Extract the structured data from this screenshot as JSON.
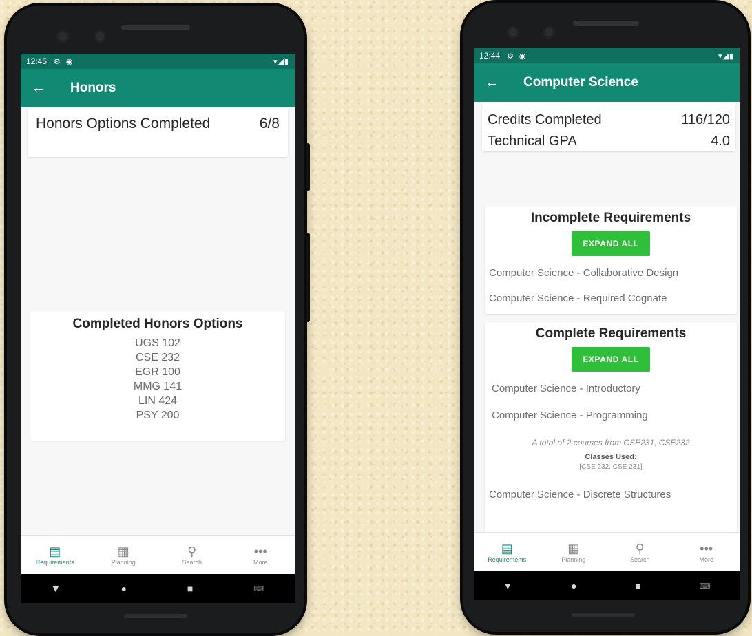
{
  "left": {
    "status": {
      "time": "12:45",
      "icons_left": [
        "⚙",
        "◉"
      ],
      "icons_right": "▾◢▮"
    },
    "appbar": {
      "title": "Honors"
    },
    "summary": {
      "label": "Honors Options Completed",
      "value": "6/8"
    },
    "completed": {
      "title": "Completed Honors Options",
      "items": [
        "UGS 102",
        "CSE 232",
        "EGR 100",
        "MMG 141",
        "LIN 424",
        "PSY 200"
      ]
    },
    "nav": [
      {
        "label": "Requirements",
        "icon": "requirements-icon",
        "glyph": "▤"
      },
      {
        "label": "Planning",
        "icon": "calendar-icon",
        "glyph": "▦"
      },
      {
        "label": "Search",
        "icon": "search-icon",
        "glyph": "⚲"
      },
      {
        "label": "More",
        "icon": "more-icon",
        "glyph": "•••"
      }
    ]
  },
  "right": {
    "status": {
      "time": "12:44",
      "icons_left": [
        "⚙",
        "◉"
      ],
      "icons_right": "▾◢▮"
    },
    "appbar": {
      "title": "Computer Science"
    },
    "credits": {
      "label": "Credits Completed",
      "value": "116/120"
    },
    "gpa": {
      "label": "Technical GPA",
      "value": "4.0"
    },
    "incomplete": {
      "title": "Incomplete Requirements",
      "button": "EXPAND ALL",
      "items": [
        "Computer Science - Collaborative Design",
        "Computer Science - Required Cognate"
      ]
    },
    "complete": {
      "title": "Complete Requirements",
      "button": "EXPAND ALL",
      "items": [
        "Computer Science - Introductory",
        "Computer Science - Programming",
        "Computer Science - Discrete Structures"
      ],
      "detail": {
        "note": "A total of 2 courses from CSE231, CSE232",
        "classes_label": "Classes Used:",
        "classes_value": "[CSE 232, CSE 231]"
      }
    },
    "nav": [
      {
        "label": "Requirements",
        "icon": "requirements-icon",
        "glyph": "▤"
      },
      {
        "label": "Planning",
        "icon": "calendar-icon",
        "glyph": "▦"
      },
      {
        "label": "Search",
        "icon": "search-icon",
        "glyph": "⚲"
      },
      {
        "label": "More",
        "icon": "more-icon",
        "glyph": "•••"
      }
    ]
  },
  "system_nav": {
    "back": "▼",
    "home": "●",
    "recents": "■",
    "keyboard": "⌨"
  },
  "colors": {
    "appbar": "#128a73",
    "statusbar": "#0f7060",
    "button": "#2fbf3b",
    "nav_active": "#1a8a75"
  }
}
